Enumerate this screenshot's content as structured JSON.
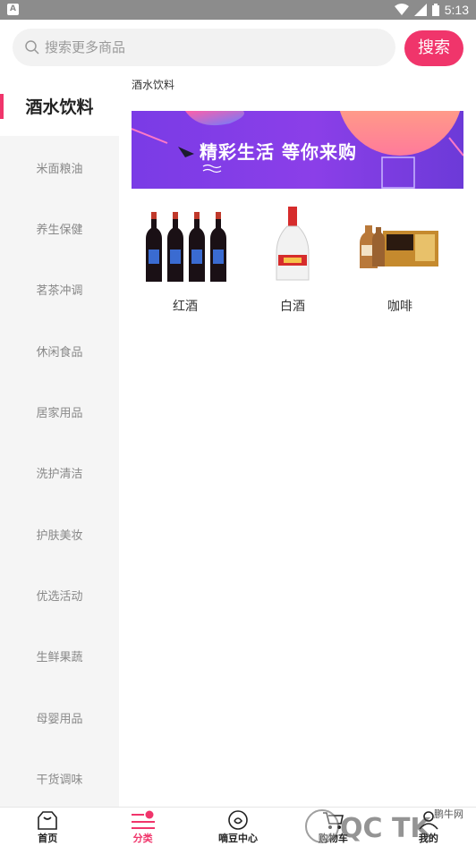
{
  "status_bar": {
    "time": "5:13",
    "app_icon_letter": "A"
  },
  "search": {
    "placeholder": "搜索更多商品",
    "button_label": "搜索"
  },
  "sidebar": {
    "items": [
      {
        "label": "酒水饮料",
        "active": true
      },
      {
        "label": "米面粮油"
      },
      {
        "label": "养生保健"
      },
      {
        "label": "茗茶冲调"
      },
      {
        "label": "休闲食品"
      },
      {
        "label": "居家用品"
      },
      {
        "label": "洗护清洁"
      },
      {
        "label": "护肤美妆"
      },
      {
        "label": "优选活动"
      },
      {
        "label": "生鲜果蔬"
      },
      {
        "label": "母婴用品"
      },
      {
        "label": "干货调味"
      }
    ]
  },
  "content": {
    "section_title": "酒水饮料",
    "banner_text": "精彩生活 等你来购",
    "products": [
      {
        "name": "红酒",
        "icon": "red-wine-bottles"
      },
      {
        "name": "白酒",
        "icon": "baijiu-bottle"
      },
      {
        "name": "咖啡",
        "icon": "coffee-bottles"
      }
    ]
  },
  "bottom_nav": {
    "items": [
      {
        "label": "首页",
        "icon": "home-icon"
      },
      {
        "label": "分类",
        "icon": "category-icon",
        "active": true
      },
      {
        "label": "嘀豆中心",
        "icon": "bean-center-icon"
      },
      {
        "label": "购物车",
        "icon": "cart-icon"
      },
      {
        "label": "我的",
        "icon": "profile-icon"
      }
    ]
  },
  "watermark": {
    "text": "鹏牛网"
  },
  "colors": {
    "accent": "#f0356b",
    "sidebar_bg": "#f5f5f5",
    "status_bar": "#8c8c8c"
  }
}
